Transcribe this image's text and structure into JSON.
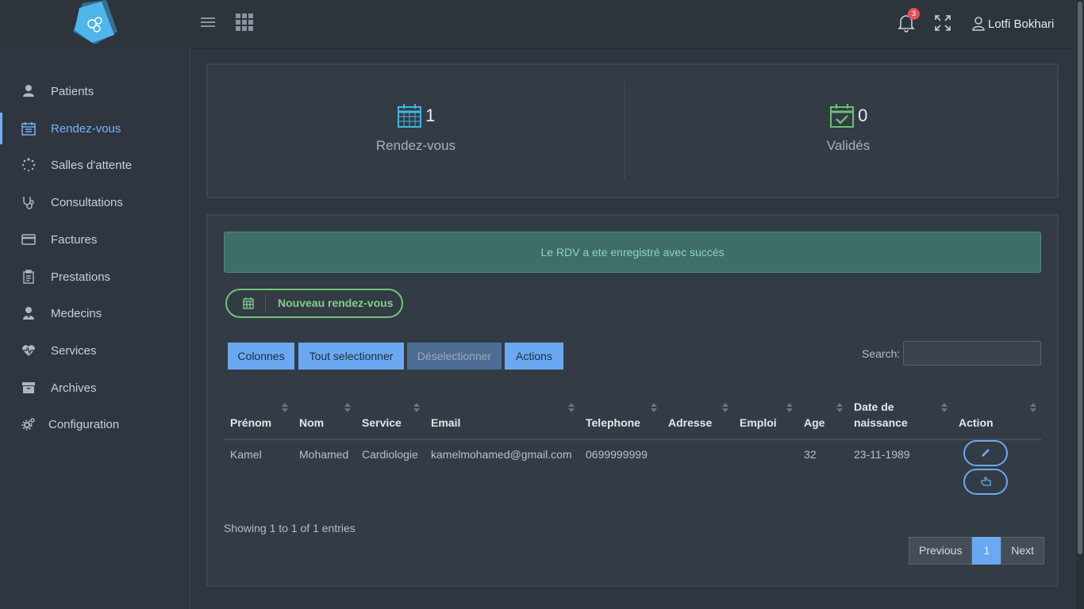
{
  "header": {
    "notification_count": "3",
    "user_name": "Lotfi Bokhari"
  },
  "sidebar": {
    "items": [
      {
        "label": "Patients",
        "icon": "user-icon"
      },
      {
        "label": "Rendez-vous",
        "icon": "calendar-icon",
        "active": true
      },
      {
        "label": "Salles d'attente",
        "icon": "spinner-icon"
      },
      {
        "label": "Consultations",
        "icon": "stethoscope-icon"
      },
      {
        "label": "Factures",
        "icon": "credit-card-icon"
      },
      {
        "label": "Prestations",
        "icon": "clipboard-icon"
      },
      {
        "label": "Medecins",
        "icon": "doctor-icon"
      },
      {
        "label": "Services",
        "icon": "heartbeat-icon"
      },
      {
        "label": "Archives",
        "icon": "archive-icon"
      },
      {
        "label": "Configuration",
        "icon": "cogs-icon"
      }
    ]
  },
  "stats": {
    "rdv": {
      "value": "1",
      "label": "Rendez-vous"
    },
    "valides": {
      "value": "0",
      "label": "Validés"
    }
  },
  "alert": {
    "text": "Le RDV a ete enregistré avec succés"
  },
  "new_button": {
    "label": "Nouveau rendez-vous"
  },
  "toolbar": {
    "columns": "Colonnes",
    "select_all": "Tout selectionner",
    "deselect": "Déselectionner",
    "actions": "Actions",
    "search_label": "Search:"
  },
  "table": {
    "headers": [
      "Prénom",
      "Nom",
      "Service",
      "Email",
      "Telephone",
      "Adresse",
      "Emploi",
      "Age",
      "Date de naissance",
      "Action"
    ],
    "rows": [
      {
        "prenom": "Kamel",
        "nom": "Mohamed",
        "service": "Cardiologie",
        "email": "kamelmohamed@gmail.com",
        "telephone": "0699999999",
        "adresse": "",
        "emploi": "",
        "age": "32",
        "date_naissance": "23-11-1989"
      }
    ]
  },
  "footer": {
    "info": "Showing 1 to 1 of 1 entries",
    "previous": "Previous",
    "current_page": "1",
    "next": "Next"
  },
  "colors": {
    "accent": "#6aa9f2",
    "success": "#6fc47a",
    "stat_blue": "#3fb8e6",
    "stat_green": "#6cc070",
    "badge": "#e8505b"
  }
}
